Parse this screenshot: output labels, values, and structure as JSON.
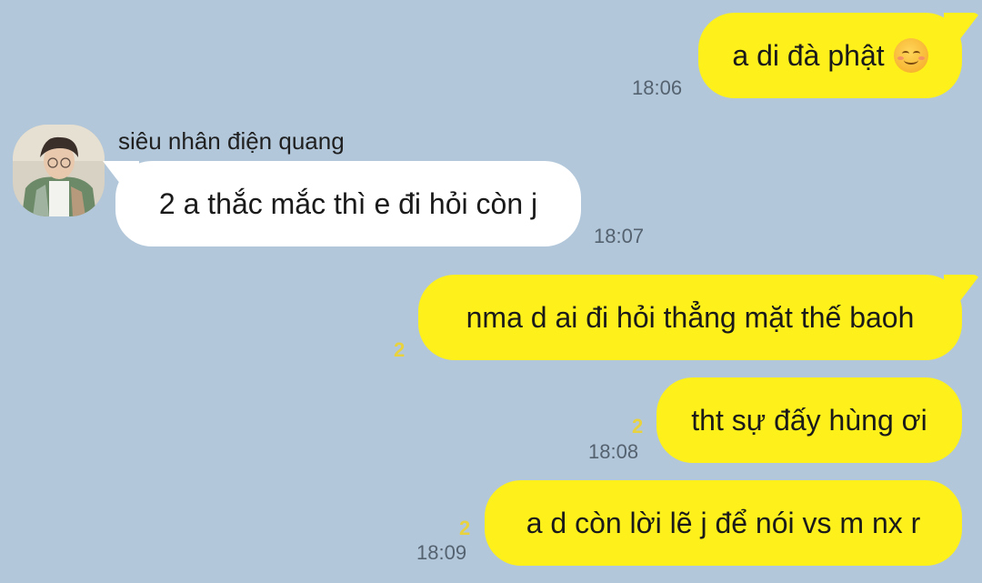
{
  "chat": {
    "background_color": "#b2c7da",
    "outgoing_color": "#fef01b",
    "incoming_color": "#ffffff",
    "messages": [
      {
        "direction": "out",
        "text": "a di đà phật",
        "emoji": "smiling-face-icon",
        "time": "18:06",
        "unread": ""
      },
      {
        "direction": "in",
        "sender": "siêu nhân điện quang",
        "text": "2 a thắc mắc thì e đi hỏi còn j",
        "time": "18:07",
        "unread": ""
      },
      {
        "direction": "out",
        "text": "nma d ai đi hỏi thẳng mặt thế baoh",
        "time": "",
        "unread": "2"
      },
      {
        "direction": "out",
        "text": "tht sự đấy hùng ơi",
        "time": "18:08",
        "unread": "2"
      },
      {
        "direction": "out",
        "text": "a d còn lời lẽ j để nói vs m nx r",
        "time": "18:09",
        "unread": "2"
      }
    ]
  }
}
